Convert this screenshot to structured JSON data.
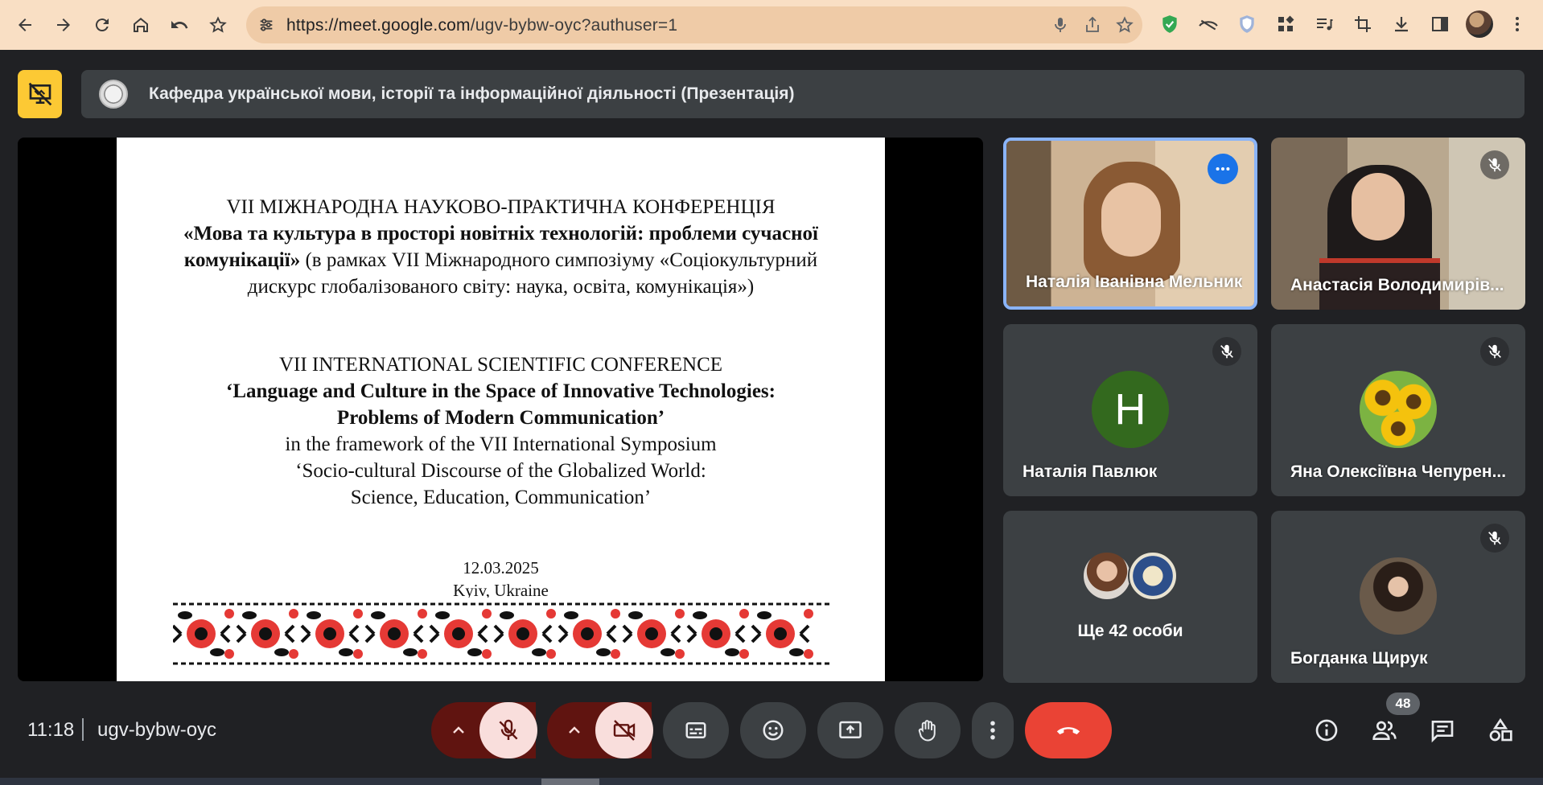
{
  "browser": {
    "url_host": "https://meet.google.com",
    "url_path": "/ugv-bybw-oyc?authuser=1",
    "icons": [
      "back-icon",
      "forward-icon",
      "reload-icon",
      "home-icon",
      "undo-icon",
      "bookmark-star-icon"
    ]
  },
  "meet": {
    "presentation_title": "Кафедра української мови, історії та інформаційної діяльності (Презентація)",
    "colors": {
      "accent_yellow": "#fcc934",
      "end_call": "#ea4335",
      "active_speaker": "#8ab4f8"
    }
  },
  "slide": {
    "ua_line1": "VII МІЖНАРОДНА НАУКОВО-ПРАКТИЧНА КОНФЕРЕНЦІЯ",
    "ua_line2": "«Мова та культура в просторі новітніх технологій: проблеми сучасної",
    "ua_line3_bold": "комунікації»",
    "ua_line3_rest": " (в рамках VII Міжнародного симпозіуму «Соціокультурний",
    "ua_line4": "дискурс глобалізованого світу: наука, освіта, комунікація»)",
    "en_line1": "VII INTERNATIONAL SCIENTIFIC CONFERENCE",
    "en_line2": "‘Language and Culture in the Space of Innovative Technologies:",
    "en_line3": "Problems of Modern Communication’",
    "en_line4": "in the framework of the VII International Symposium",
    "en_line5": "‘Socio-cultural Discourse of the Globalized World:",
    "en_line6": "Science, Education, Communication’",
    "date": "12.03.2025",
    "place": "Kyiv, Ukraine"
  },
  "participants": [
    {
      "name": "Наталія Іванівна Мельник",
      "video": true,
      "speaking": true
    },
    {
      "name": "Анастасія Володимирів...",
      "video": true,
      "muted": true
    },
    {
      "name": "Наталія Павлюк",
      "initial": "H",
      "avatar_color": "#33691e",
      "muted": true
    },
    {
      "name": "Яна Олексіївна Чепурен...",
      "muted": true
    },
    {
      "name": "Ще 42 особи"
    },
    {
      "name": "Богданка Щирук",
      "muted": true
    }
  ],
  "bottom": {
    "time": "11:18",
    "meeting_code": "ugv-bybw-oyc",
    "participant_count": "48"
  }
}
